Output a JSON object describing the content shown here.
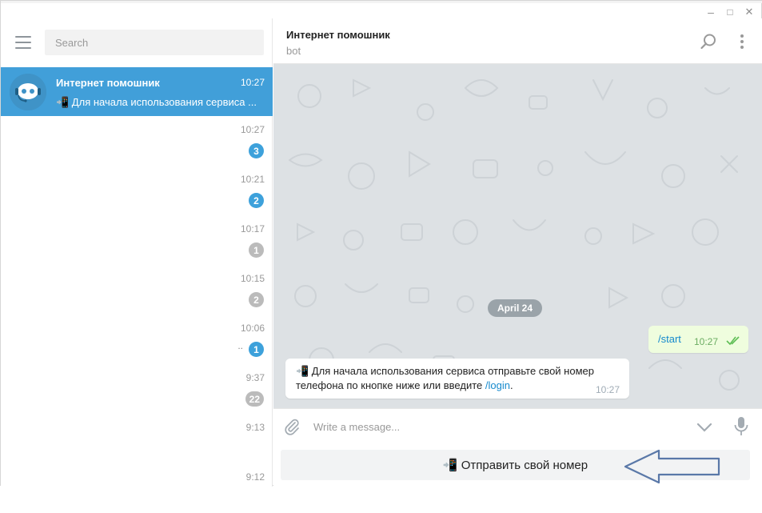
{
  "window": {
    "minimize": "–",
    "maximize": "□",
    "close": "✕"
  },
  "sidebar": {
    "search_placeholder": "Search",
    "active_chat": {
      "name": "Интернет помошник",
      "time": "10:27",
      "preview": "📲 Для начала использования сервиса ..."
    },
    "chats": [
      {
        "time": "10:27",
        "badge": "3",
        "badge_color": "#3da1db"
      },
      {
        "time": "10:21",
        "badge": "2",
        "badge_color": "#3da1db"
      },
      {
        "time": "10:17",
        "badge": "1",
        "badge_color": "#bbbbbb"
      },
      {
        "time": "10:15",
        "badge": "2",
        "badge_color": "#bbbbbb"
      },
      {
        "time": "10:06",
        "badge": "1",
        "badge_color": "#3da1db",
        "prefix": ".."
      },
      {
        "time": "9:37",
        "badge": "22",
        "badge_color": "#bbbbbb"
      },
      {
        "time": "9:13",
        "badge": ""
      },
      {
        "time": "9:12",
        "badge": ""
      }
    ]
  },
  "chat": {
    "title": "Интернет помошник",
    "status": "bot",
    "date_divider": "April 24",
    "outgoing": {
      "text": "/start",
      "time": "10:27"
    },
    "incoming": {
      "text_before": "📲 Для начала использования сервиса отправьте свой номер телефона по кнопке ниже или введите ",
      "link": "/login",
      "text_after": ".",
      "time": "10:27"
    }
  },
  "composer": {
    "placeholder": "Write a message..."
  },
  "bot_keyboard": {
    "button_label": "📲 Отправить свой номер"
  },
  "colors": {
    "accent": "#419fd9",
    "chat_bg": "#dde1e4",
    "outgoing_bubble": "#effdde",
    "link": "#168acd"
  }
}
